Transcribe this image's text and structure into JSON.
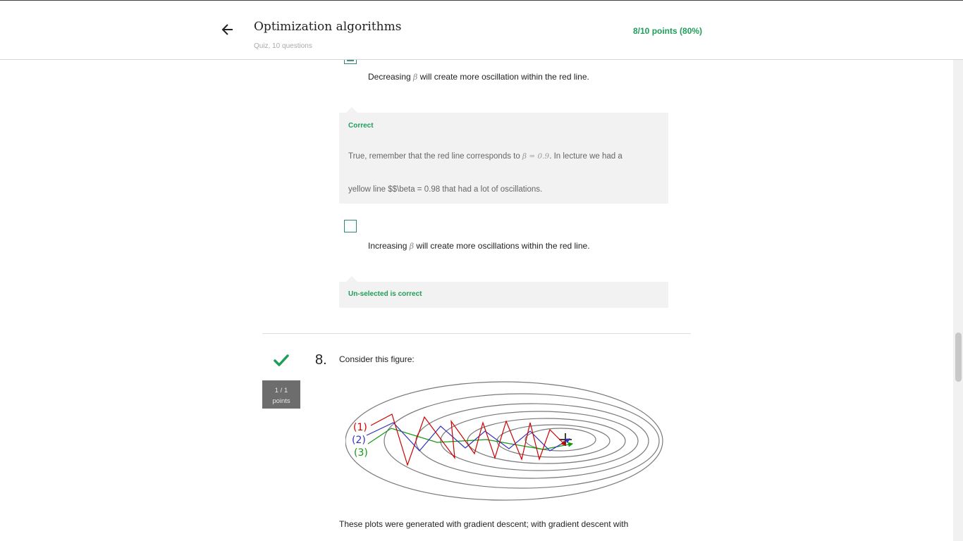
{
  "header": {
    "title": "Optimization algorithms",
    "subtitle": "Quiz, 10 questions",
    "score": "8/10 points (80%)"
  },
  "question7": {
    "option_decreasing": {
      "prefix": "Decreasing",
      "beta": "β",
      "suffix": "will create more oscillation within the red line.",
      "checked": true,
      "feedback_label": "Correct",
      "feedback_line1_prefix": "True, remember that the red line corresponds to",
      "feedback_line1_math": "β = 0.9",
      "feedback_line1_suffix": ". In lecture we had a",
      "feedback_line2": "yellow line $$\\beta = 0.98 that had a lot of oscillations."
    },
    "option_increasing": {
      "prefix": "Increasing",
      "beta": "β",
      "suffix": "will create more oscillations within the red line.",
      "checked": false,
      "feedback_label": "Un-selected is correct"
    }
  },
  "question8": {
    "number": "8.",
    "points": "1 / 1",
    "points_label": "points",
    "prompt": "Consider this figure:",
    "figure_labels": [
      "(1)",
      "(2)",
      "(3)"
    ],
    "bottom_text": "These plots were generated with gradient descent; with gradient descent with"
  },
  "colors": {
    "accent_green": "#1f9e5a",
    "checkbox_border": "#2a8a7a",
    "path1": "#cc0000",
    "path2": "#3333bb",
    "path3": "#119911"
  }
}
